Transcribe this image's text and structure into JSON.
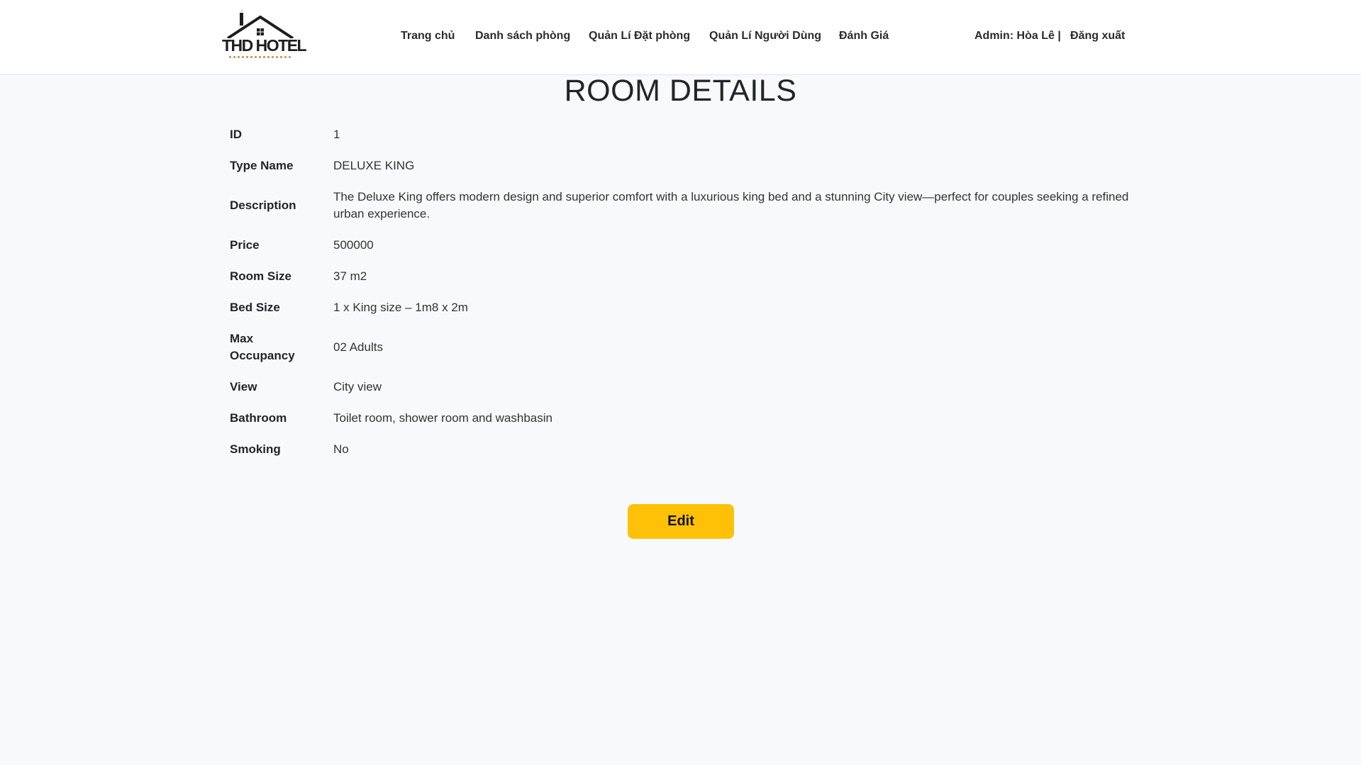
{
  "header": {
    "logo_text": "THD HOTEL",
    "nav": [
      {
        "label": "Trang chủ"
      },
      {
        "label": "Danh sách phòng"
      },
      {
        "label": "Quản Lí Đặt phòng"
      },
      {
        "label": "Quản Lí Người Dùng"
      },
      {
        "label": "Đánh Giá"
      }
    ],
    "admin_label": "Admin: Hòa Lê |",
    "logout_label": "Đăng xuất"
  },
  "page": {
    "title": "ROOM DETAILS"
  },
  "details": [
    {
      "label": "ID",
      "value": "1"
    },
    {
      "label": "Type Name",
      "value": "DELUXE KING"
    },
    {
      "label": "Description",
      "value": "The Deluxe King offers modern design and superior comfort with a luxurious king bed and a stunning City view—perfect for couples seeking a refined urban experience."
    },
    {
      "label": "Price",
      "value": "500000"
    },
    {
      "label": "Room Size",
      "value": "37 m2"
    },
    {
      "label": "Bed Size",
      "value": "1 x King size – 1m8 x 2m"
    },
    {
      "label": "Max Occupancy",
      "value": "02 Adults"
    },
    {
      "label": "View",
      "value": "City view"
    },
    {
      "label": "Bathroom",
      "value": "Toilet room, shower room and washbasin"
    },
    {
      "label": "Smoking",
      "value": "No"
    }
  ],
  "actions": {
    "edit_label": "Edit"
  },
  "colors": {
    "accent": "#ffc107",
    "background": "#f8f9fa",
    "header_bg": "#ffffff"
  }
}
